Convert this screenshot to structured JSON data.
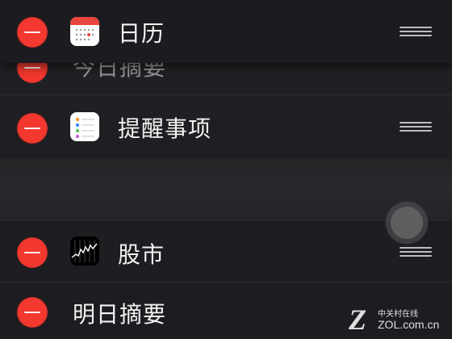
{
  "rows": [
    {
      "label": "日历",
      "icon": "calendar-icon"
    },
    {
      "label": "今日摘要"
    },
    {
      "label": "提醒事项",
      "icon": "reminders-icon"
    },
    {
      "label": "股市",
      "icon": "stocks-icon"
    },
    {
      "label": "明日摘要"
    }
  ],
  "watermark": {
    "brand": "中关村在线",
    "site": "ZOL.com.cn"
  },
  "colors": {
    "delete_red": "#f2382f",
    "background": "#1f1e22"
  }
}
